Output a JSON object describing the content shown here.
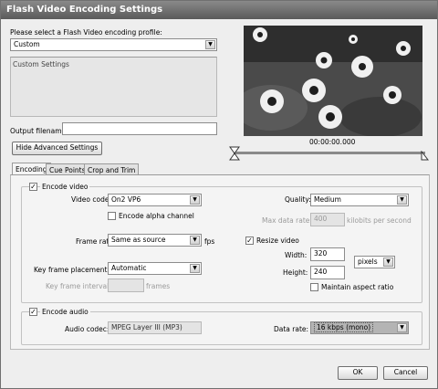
{
  "window": {
    "title": "Flash Video Encoding Settings"
  },
  "profile": {
    "label": "Please select a Flash Video encoding profile:",
    "selected": "Custom",
    "description": "Custom Settings"
  },
  "output": {
    "label": "Output filename:",
    "value": ""
  },
  "preview": {
    "timecode": "00:00:00.000"
  },
  "advanced_button": "Hide Advanced Settings",
  "tabs": [
    {
      "label": "Encoding",
      "active": true
    },
    {
      "label": "Cue Points",
      "active": false
    },
    {
      "label": "Crop and Trim",
      "active": false
    }
  ],
  "video": {
    "encode_label": "Encode video",
    "encode_checked": true,
    "codec_label": "Video codec:",
    "codec": "On2 VP6",
    "alpha_label": "Encode alpha channel",
    "alpha_checked": false,
    "frame_rate_label": "Frame rate:",
    "frame_rate": "Same as source",
    "fps_unit": "fps",
    "keyframe_label": "Key frame placement:",
    "keyframe": "Automatic",
    "keyframe_interval_label": "Key frame interval:",
    "keyframe_interval": "",
    "frames_unit": "frames",
    "quality_label": "Quality:",
    "quality": "Medium",
    "max_rate_label": "Max data rate:",
    "max_rate": "400",
    "max_rate_unit": "kilobits per second",
    "resize_label": "Resize video",
    "resize_checked": true,
    "width_label": "Width:",
    "width": "320",
    "height_label": "Height:",
    "height": "240",
    "units": "pixels",
    "aspect_label": "Maintain aspect ratio",
    "aspect_checked": false
  },
  "audio": {
    "encode_label": "Encode audio",
    "encode_checked": true,
    "codec_label": "Audio codec:",
    "codec": "MPEG Layer III (MP3)",
    "rate_label": "Data rate:",
    "rate": "16 kbps (mono)"
  },
  "buttons": {
    "ok": "OK",
    "cancel": "Cancel"
  },
  "icons": {
    "dropdown": "chevron-down-icon",
    "checkmark": "checkmark-icon",
    "in_marker": "in-point-icon",
    "out_marker": "out-point-icon"
  }
}
